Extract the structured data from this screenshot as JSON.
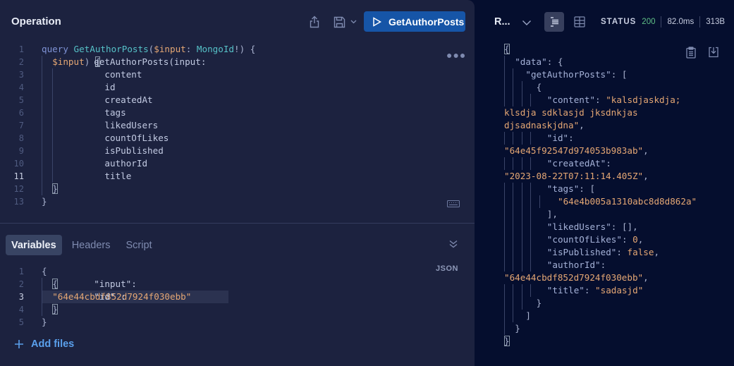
{
  "operation": {
    "title": "Operation",
    "run_button_label": "GetAuthorPosts",
    "icons": [
      "share-icon",
      "save-icon",
      "chevron-down-icon",
      "play-icon",
      "more-icon",
      "keyboard-icon"
    ],
    "active_line": 11,
    "lines": [
      {
        "n": "1",
        "segments": [
          [
            "kw",
            "query "
          ],
          [
            "fn",
            "GetAuthorPosts"
          ],
          [
            "punct",
            "("
          ],
          [
            "var",
            "$input"
          ],
          [
            "punct",
            ": "
          ],
          [
            "type",
            "MongoId"
          ],
          [
            "punct",
            "!) {"
          ]
        ]
      },
      {
        "n": "2",
        "segments": [
          [
            "code",
            "getAuthorPosts(input: "
          ],
          [
            "var",
            "$input"
          ],
          [
            "punct",
            ") "
          ],
          [
            "hl",
            "{"
          ]
        ]
      },
      {
        "n": "3",
        "segments": [
          [
            "code",
            "content"
          ]
        ]
      },
      {
        "n": "4",
        "segments": [
          [
            "code",
            "id"
          ]
        ]
      },
      {
        "n": "5",
        "segments": [
          [
            "code",
            "createdAt"
          ]
        ]
      },
      {
        "n": "6",
        "segments": [
          [
            "code",
            "tags"
          ]
        ]
      },
      {
        "n": "7",
        "segments": [
          [
            "code",
            "likedUsers"
          ]
        ]
      },
      {
        "n": "8",
        "segments": [
          [
            "code",
            "countOfLikes"
          ]
        ]
      },
      {
        "n": "9",
        "segments": [
          [
            "code",
            "isPublished"
          ]
        ]
      },
      {
        "n": "10",
        "segments": [
          [
            "code",
            "authorId"
          ]
        ]
      },
      {
        "n": "11",
        "segments": [
          [
            "code",
            "title"
          ]
        ]
      },
      {
        "n": "12",
        "segments": [
          [
            "hl",
            "}"
          ]
        ]
      },
      {
        "n": "13",
        "segments": [
          [
            "punct",
            "}"
          ]
        ]
      }
    ]
  },
  "variables": {
    "tabs": [
      {
        "label": "Variables",
        "active": true
      },
      {
        "label": "Headers",
        "active": false
      },
      {
        "label": "Script",
        "active": false
      }
    ],
    "format_label": "JSON",
    "add_files_label": "Add files",
    "active_line": 3,
    "lines": [
      {
        "n": "1",
        "segments": [
          [
            "punct",
            "{"
          ]
        ]
      },
      {
        "n": "2",
        "segments": [
          [
            "code",
            "\"input\":  "
          ],
          [
            "hl",
            "{"
          ]
        ]
      },
      {
        "n": "3",
        "segments": [
          [
            "code",
            "\"id\" :"
          ],
          [
            "str",
            "\"64e44cbdf852d7924f030ebb\""
          ]
        ]
      },
      {
        "n": "4",
        "segments": [
          [
            "hl",
            "}"
          ]
        ]
      },
      {
        "n": "5",
        "segments": [
          [
            "punct",
            "}"
          ]
        ]
      }
    ]
  },
  "response": {
    "title": "R...",
    "status_label": "STATUS",
    "status_code": "200",
    "time": "82.0ms",
    "size": "313B",
    "colors": {
      "status_ok": "#5fbf86",
      "accent": "#1655a7",
      "string": "#e5a774"
    },
    "lines": [
      {
        "guides": 0,
        "indent": 0,
        "segments": [
          [
            "hl",
            "{"
          ]
        ]
      },
      {
        "guides": 1,
        "indent": 1,
        "segments": [
          [
            "rkey",
            "\"data\""
          ],
          [
            "p",
            ": {"
          ]
        ]
      },
      {
        "guides": 2,
        "indent": 2,
        "segments": [
          [
            "rkey",
            "\"getAuthorPosts\""
          ],
          [
            "p",
            ": ["
          ]
        ]
      },
      {
        "guides": 3,
        "indent": 3,
        "segments": [
          [
            "p",
            "{"
          ]
        ]
      },
      {
        "guides": 4,
        "indent": 4,
        "segments": [
          [
            "rkey",
            "\"content\""
          ],
          [
            "p",
            ": "
          ],
          [
            "rstr",
            "\"kalsdjaskdja;"
          ]
        ]
      },
      {
        "guides": 0,
        "indent": 0,
        "segments": [
          [
            "rstr",
            "klsdja sdklasjd jksdnkjas"
          ]
        ]
      },
      {
        "guides": 0,
        "indent": 0,
        "segments": [
          [
            "rstr",
            "djsadnaskjdna\""
          ],
          [
            "p",
            ","
          ]
        ]
      },
      {
        "guides": 4,
        "indent": 4,
        "segments": [
          [
            "rkey",
            "\"id\""
          ],
          [
            "p",
            ":"
          ]
        ]
      },
      {
        "guides": 0,
        "indent": 0,
        "segments": [
          [
            "rstr",
            "\"64e45f92547d974053b983ab\""
          ],
          [
            "p",
            ","
          ]
        ]
      },
      {
        "guides": 4,
        "indent": 4,
        "segments": [
          [
            "rkey",
            "\"createdAt\""
          ],
          [
            "p",
            ":"
          ]
        ]
      },
      {
        "guides": 0,
        "indent": 0,
        "segments": [
          [
            "rstr",
            "\"2023-08-22T07:11:14.405Z\""
          ],
          [
            "p",
            ","
          ]
        ]
      },
      {
        "guides": 4,
        "indent": 4,
        "segments": [
          [
            "rkey",
            "\"tags\""
          ],
          [
            "p",
            ": ["
          ]
        ]
      },
      {
        "guides": 5,
        "indent": 5,
        "segments": [
          [
            "rstr",
            "\"64e4b005a1310abc8d8d862a\""
          ]
        ]
      },
      {
        "guides": 4,
        "indent": 4,
        "segments": [
          [
            "p",
            "],"
          ]
        ]
      },
      {
        "guides": 4,
        "indent": 4,
        "segments": [
          [
            "rkey",
            "\"likedUsers\""
          ],
          [
            "p",
            ": [],"
          ]
        ]
      },
      {
        "guides": 4,
        "indent": 4,
        "segments": [
          [
            "rkey",
            "\"countOfLikes\""
          ],
          [
            "p",
            ": "
          ],
          [
            "rnum",
            "0"
          ],
          [
            "p",
            ","
          ]
        ]
      },
      {
        "guides": 4,
        "indent": 4,
        "segments": [
          [
            "rkey",
            "\"isPublished\""
          ],
          [
            "p",
            ": "
          ],
          [
            "rnum",
            "false"
          ],
          [
            "p",
            ","
          ]
        ]
      },
      {
        "guides": 4,
        "indent": 4,
        "segments": [
          [
            "rkey",
            "\"authorId\""
          ],
          [
            "p",
            ":"
          ]
        ]
      },
      {
        "guides": 0,
        "indent": 0,
        "segments": [
          [
            "rstr",
            "\"64e44cbdf852d7924f030ebb\""
          ],
          [
            "p",
            ","
          ]
        ]
      },
      {
        "guides": 4,
        "indent": 4,
        "segments": [
          [
            "rkey",
            "\"title\""
          ],
          [
            "p",
            ": "
          ],
          [
            "rstr",
            "\"sadasjd\""
          ]
        ]
      },
      {
        "guides": 3,
        "indent": 3,
        "segments": [
          [
            "p",
            "}"
          ]
        ]
      },
      {
        "guides": 2,
        "indent": 2,
        "segments": [
          [
            "p",
            "]"
          ]
        ]
      },
      {
        "guides": 1,
        "indent": 1,
        "segments": [
          [
            "p",
            "}"
          ]
        ]
      },
      {
        "guides": 0,
        "indent": 0,
        "segments": [
          [
            "hl",
            "}"
          ]
        ]
      }
    ]
  }
}
